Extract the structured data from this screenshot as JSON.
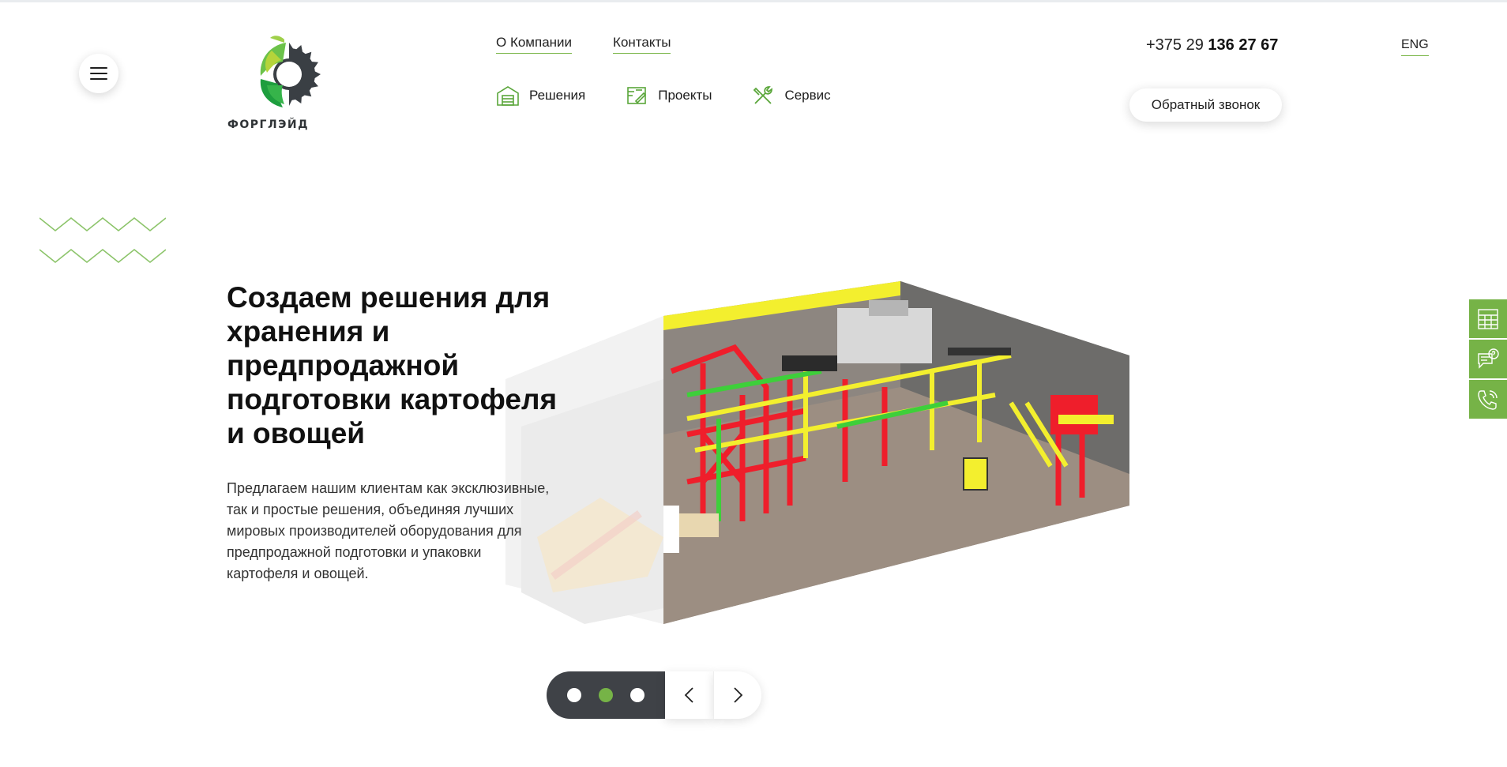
{
  "header": {
    "logo_text": "ФОРГЛЭЙД",
    "top_links": [
      {
        "label": "О Компании"
      },
      {
        "label": "Контакты"
      }
    ],
    "nav": [
      {
        "label": "Решения",
        "icon": "warehouse-icon"
      },
      {
        "label": "Проекты",
        "icon": "blueprint-icon"
      },
      {
        "label": "Сервис",
        "icon": "tools-icon"
      }
    ],
    "phone_prefix": "+375 29",
    "phone_number": "136 27 67",
    "lang": "ENG",
    "callback_label": "Обратный звонок"
  },
  "hero": {
    "title": "Создаем решения для хранения и предпродажной подготовки картофеля и овощей",
    "text": "Предлагаем нашим клиентам как эксклюзивные, так и простые решения, объединяя лучших мировых производителей оборудования для предпродажной подготовки и упаковки картофеля и овощей."
  },
  "slider": {
    "total": 3,
    "active": 2
  },
  "side_panel": {
    "icons": [
      "calculator-icon",
      "chat-question-icon",
      "phone-call-icon"
    ]
  },
  "colors": {
    "accent": "#76b347",
    "dark": "#3f4247"
  }
}
